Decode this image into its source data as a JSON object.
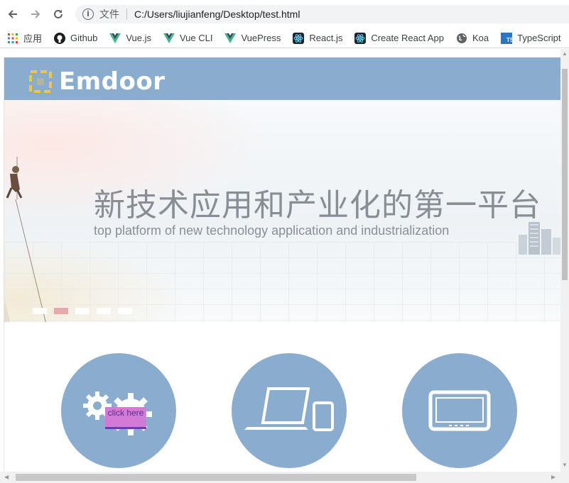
{
  "browser": {
    "back_icon": "arrow-left-icon",
    "forward_icon": "arrow-right-icon",
    "reload_icon": "reload-icon",
    "address": {
      "info_icon": "info-icon",
      "scheme_label": "文件",
      "url": "C:/Users/liujianfeng/Desktop/test.html"
    },
    "bookmarks": [
      {
        "label": "应用",
        "icon": "apps-grid-icon"
      },
      {
        "label": "Github",
        "icon": "github-icon"
      },
      {
        "label": "Vue.js",
        "icon": "vue-icon"
      },
      {
        "label": "Vue CLI",
        "icon": "vue-icon"
      },
      {
        "label": "VuePress",
        "icon": "vue-icon"
      },
      {
        "label": "React.js",
        "icon": "react-icon"
      },
      {
        "label": "Create React App",
        "icon": "react-icon"
      },
      {
        "label": "Koa",
        "icon": "globe-icon"
      },
      {
        "label": "TypeScript",
        "icon": "typescript-icon"
      }
    ]
  },
  "site": {
    "logo_text": "Emdoor",
    "brand_color": "#8aaccf",
    "banner": {
      "title": "新技术应用和产业化的第一平台",
      "subtitle": "top platform of new technology application and industrialization",
      "active_slide": 2,
      "slide_count": 5
    },
    "features": [
      {
        "icon": "gears-icon",
        "overlay": "click here"
      },
      {
        "icon": "laptop-tablet-icon"
      },
      {
        "icon": "rugged-tablet-icon"
      }
    ]
  }
}
